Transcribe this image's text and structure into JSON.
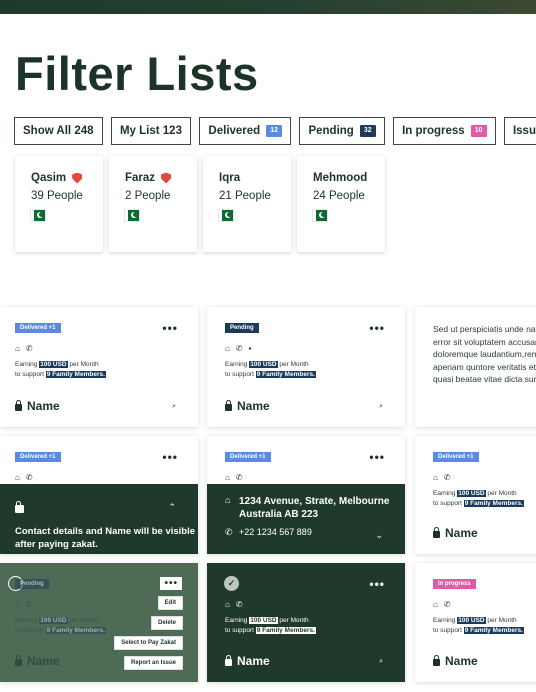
{
  "page": {
    "title": "Filter Lists"
  },
  "tabs": [
    {
      "label": "Show All 248",
      "badge": "",
      "badge_color": ""
    },
    {
      "label": "My List 123",
      "badge": "",
      "badge_color": ""
    },
    {
      "label": "Delivered",
      "badge": "12",
      "badge_color": "#5a8be0"
    },
    {
      "label": "Pending",
      "badge": "32",
      "badge_color": "#1c3a5a"
    },
    {
      "label": "In progress",
      "badge": "10",
      "badge_color": "#e05aa8"
    },
    {
      "label": "Issue",
      "badge": "",
      "badge_color": ""
    }
  ],
  "people": [
    {
      "name": "Qasim",
      "count": "39 People",
      "verified": true
    },
    {
      "name": "Faraz",
      "count": "2 People",
      "verified": true
    },
    {
      "name": "Iqra",
      "count": "21 People",
      "verified": false
    },
    {
      "name": "Mehmood",
      "count": "24 People",
      "verified": false
    }
  ],
  "common": {
    "earning_prefix": "Earning",
    "amount": "100 USD",
    "earning_mid": "per Month",
    "support_prefix": "to support",
    "members": "9 Family Members.",
    "name_label": "Name",
    "more": "•••"
  },
  "cards": {
    "c1": {
      "status": "Delivered +1",
      "status_color": "#5a8be0"
    },
    "c2": {
      "status": "Pending",
      "status_color": "#1c3a5a"
    },
    "c3": {
      "lorem": "Sed ut perspiciatis unde natus error sit voluptatem accusantium doloremque laudantium,rem aperiam quntore veritatis et quasi beatae vitae dicta sunt e"
    },
    "c4": {
      "status": "Delivered +1",
      "banner": "Contact details and Name will be visible after paying zakat."
    },
    "c5": {
      "status": "Delivered +1",
      "address": "1234 Avenue, Strate, Melbourne Australia AB 223",
      "phone": "+22 1234 567 889"
    },
    "c6": {
      "status": "Delivered +1"
    },
    "c7": {
      "status": "Pending",
      "menu": [
        "Edit",
        "Delete",
        "Select to Pay Zakat",
        "Report an Issue"
      ]
    },
    "c8": {},
    "c9": {
      "status": "In progress",
      "status_color": "#e05aa8"
    }
  }
}
